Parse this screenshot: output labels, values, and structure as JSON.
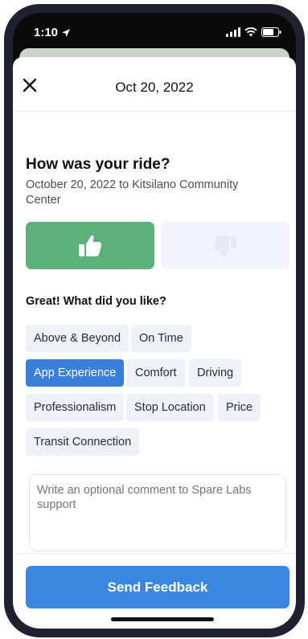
{
  "status_bar": {
    "time": "1:10",
    "location_icon": "location-arrow-icon",
    "signal_icon": "signal-bars-icon",
    "wifi_icon": "wifi-icon",
    "battery_icon": "battery-icon"
  },
  "header": {
    "close_icon": "close-icon",
    "title": "Oct 20, 2022"
  },
  "rating": {
    "question": "How was your ride?",
    "subtitle": "October 20, 2022 to Kitsilano Community Center",
    "thumbs_up_icon": "thumbs-up-icon",
    "thumbs_down_icon": "thumbs-down-icon",
    "selected": "thumbs-up"
  },
  "likes": {
    "label": "Great! What did you like?",
    "chips": [
      {
        "label": "Above & Beyond",
        "selected": false
      },
      {
        "label": "On Time",
        "selected": false
      },
      {
        "label": "App Experience",
        "selected": true
      },
      {
        "label": "Comfort",
        "selected": false
      },
      {
        "label": "Driving",
        "selected": false
      },
      {
        "label": "Professionalism",
        "selected": false
      },
      {
        "label": "Stop Location",
        "selected": false
      },
      {
        "label": "Price",
        "selected": false
      },
      {
        "label": "Transit Connection",
        "selected": false
      }
    ]
  },
  "comment": {
    "placeholder": "Write an optional comment to Spare Labs support",
    "value": ""
  },
  "footer": {
    "send_label": "Send Feedback"
  },
  "colors": {
    "thumbs_up": "#5cb07a",
    "selected_chip": "#3b7fdc",
    "send_button": "#3b86e1",
    "chip_background": "#eef1f8"
  }
}
